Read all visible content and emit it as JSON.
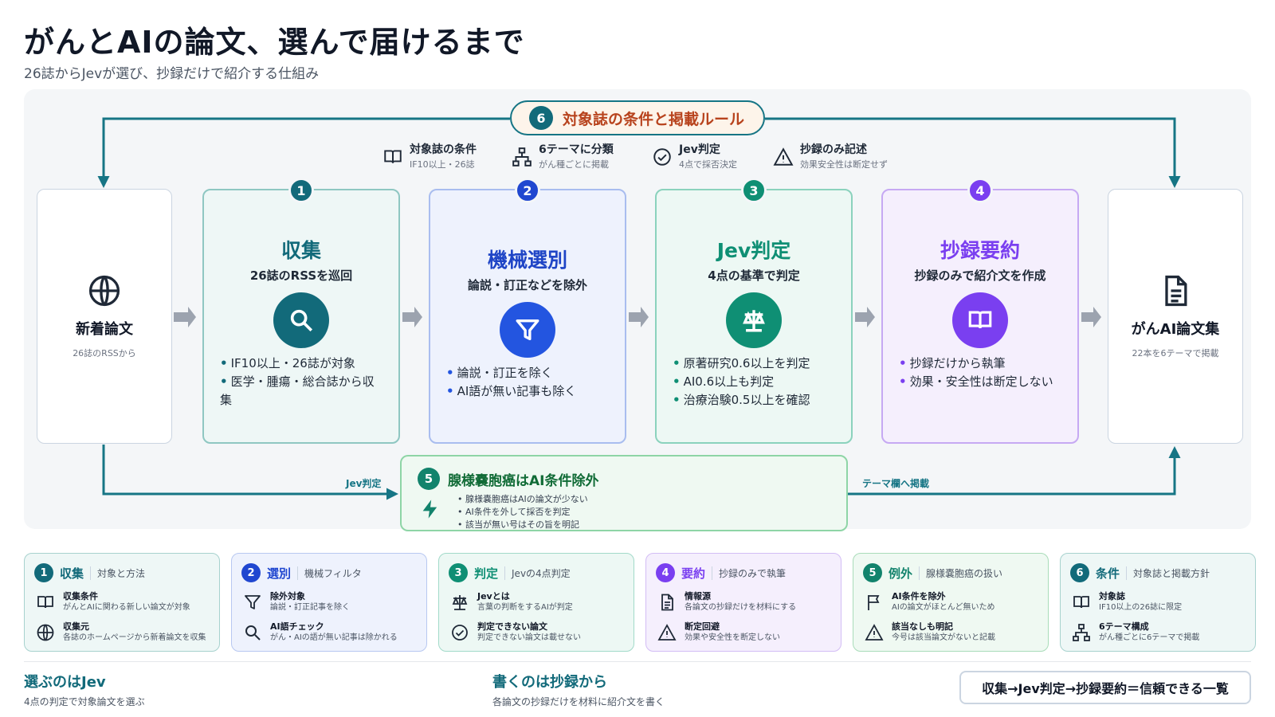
{
  "header": {
    "title": "がんとAIの論文、選んで届けるまで",
    "subtitle": "26誌からJevが選び、抄録だけで紹介する仕組み"
  },
  "rules": {
    "num": "6",
    "title": "対象誌の条件と掲載ルール",
    "items": [
      {
        "title": "対象誌の条件",
        "sub": "IF10以上・26誌",
        "icon": "book-icon"
      },
      {
        "title": "6テーマに分類",
        "sub": "がん種ごとに掲載",
        "icon": "hierarchy-icon"
      },
      {
        "title": "Jev判定",
        "sub": "4点で採否決定",
        "icon": "check-circle-icon"
      },
      {
        "title": "抄録のみ記述",
        "sub": "効果安全性は断定せず",
        "icon": "warning-icon"
      }
    ]
  },
  "source": {
    "title": "新着論文",
    "sub": "26誌のRSSから",
    "icon": "globe-icon"
  },
  "output": {
    "title": "がんAI論文集",
    "sub": "22本を6テーマで掲載",
    "icon": "document-icon"
  },
  "stages": [
    {
      "num": "1",
      "title": "収集",
      "sub": "26誌のRSSを巡回",
      "icon": "search-icon",
      "color": "#126a7a",
      "bullets": [
        "IF10以上・26誌が対象",
        "医学・腫瘍・総合誌から収集"
      ]
    },
    {
      "num": "2",
      "title": "機械選別",
      "sub": "論説・訂正などを除外",
      "icon": "filter-icon",
      "color": "#2355e0",
      "bullets": [
        "論説・訂正を除く",
        "AI語が無い記事も除く"
      ]
    },
    {
      "num": "3",
      "title": "Jev判定",
      "sub": "4点の基準で判定",
      "icon": "judge-icon",
      "color": "#0f8f74",
      "bullets": [
        "原著研究0.6以上を判定",
        "AI0.6以上も判定",
        "治療治験0.5以上を確認"
      ]
    },
    {
      "num": "4",
      "title": "抄録要約",
      "sub": "抄録のみで紹介文を作成",
      "icon": "book-open-icon",
      "color": "#7a3ff0",
      "bullets": [
        "抄録だけから執筆",
        "効果・安全性は断定しない"
      ]
    }
  ],
  "exception": {
    "num": "5",
    "title": "腺様嚢胞癌はAI条件除外",
    "icon": "lightning-icon",
    "bullets": [
      "腺様嚢胞癌はAIの論文が少ない",
      "AI条件を外して採否を判定",
      "該当が無い号はその旨を明記"
    ],
    "label_in": "Jev判定",
    "label_out": "テーマ欄へ掲載"
  },
  "legend": [
    {
      "num": "1",
      "title": "収集",
      "sub": "対象と方法",
      "rows": [
        {
          "icon": "book-icon",
          "t": "収集条件",
          "d": "がんとAIに関わる新しい論文が対象"
        },
        {
          "icon": "globe-icon",
          "t": "収集元",
          "d": "各誌のホームページから新着論文を収集"
        }
      ]
    },
    {
      "num": "2",
      "title": "選別",
      "sub": "機械フィルタ",
      "rows": [
        {
          "icon": "filter-icon",
          "t": "除外対象",
          "d": "論説・訂正記事を除く"
        },
        {
          "icon": "search-icon",
          "t": "AI語チェック",
          "d": "がん・AIの語が無い記事は除かれる"
        }
      ]
    },
    {
      "num": "3",
      "title": "判定",
      "sub": "Jevの4点判定",
      "rows": [
        {
          "icon": "judge-icon",
          "t": "Jevとは",
          "d": "言葉の判断をするAIが判定"
        },
        {
          "icon": "check-circle-icon",
          "t": "判定できない論文",
          "d": "判定できない論文は載せない"
        }
      ]
    },
    {
      "num": "4",
      "title": "要約",
      "sub": "抄録のみで執筆",
      "rows": [
        {
          "icon": "document-icon",
          "t": "情報源",
          "d": "各論文の抄録だけを材料にする"
        },
        {
          "icon": "warning-icon",
          "t": "断定回避",
          "d": "効果や安全性を断定しない"
        }
      ]
    },
    {
      "num": "5",
      "title": "例外",
      "sub": "腺様嚢胞癌の扱い",
      "rows": [
        {
          "icon": "flag-icon",
          "t": "AI条件を除外",
          "d": "AIの論文がほとんど無いため"
        },
        {
          "icon": "warning-icon",
          "t": "該当なしも明記",
          "d": "今号は該当論文がないと記載"
        }
      ]
    },
    {
      "num": "6",
      "title": "条件",
      "sub": "対象誌と掲載方針",
      "rows": [
        {
          "icon": "book-icon",
          "t": "対象誌",
          "d": "IF10以上の26誌に限定"
        },
        {
          "icon": "hierarchy-icon",
          "t": "6テーマ構成",
          "d": "がん種ごとに6テーマで掲載"
        }
      ]
    }
  ],
  "footer": {
    "left_title": "選ぶのはJev",
    "left_sub": "4点の判定で対象論文を選ぶ",
    "mid_title": "書くのは抄録から",
    "mid_sub": "各論文の抄録だけを材料に紹介文を書く",
    "summary": "収集→Jev判定→抄録要約＝信頼できる一覧"
  }
}
